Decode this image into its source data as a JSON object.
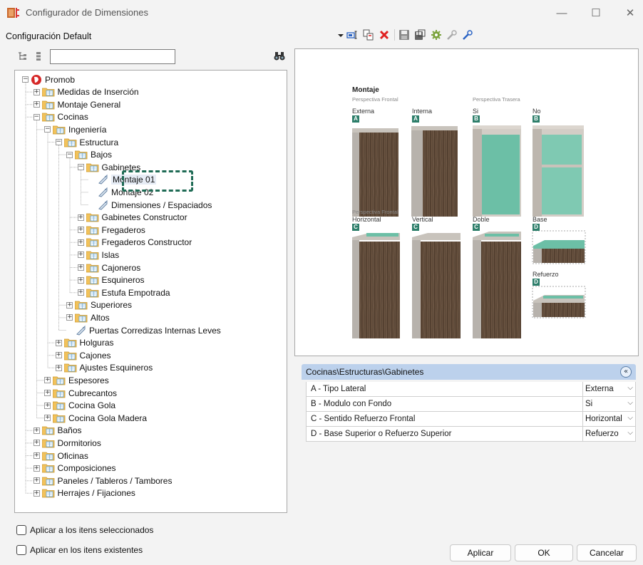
{
  "window": {
    "title": "Configurador de Dimensiones",
    "minimize_glyph": "—",
    "maximize_glyph": "☐",
    "close_glyph": "✕"
  },
  "config": {
    "label": "Configuración Default",
    "toolbar_icons": [
      "dropdown-arrow-icon",
      "rename-icon",
      "copy-icon",
      "delete-icon",
      "save-icon",
      "save-as-icon",
      "settings-icon",
      "link-icon",
      "unlink-icon"
    ]
  },
  "search": {
    "value": "",
    "placeholder": ""
  },
  "tree": [
    {
      "label": "Promob",
      "level": 0,
      "type": "root",
      "exp": "−"
    },
    {
      "label": "Medidas de Inserción",
      "level": 1,
      "type": "folder",
      "exp": "+"
    },
    {
      "label": "Montaje General",
      "level": 1,
      "type": "folder",
      "exp": "+"
    },
    {
      "label": "Cocinas",
      "level": 1,
      "type": "folder",
      "exp": "−"
    },
    {
      "label": "Ingeniería",
      "level": 2,
      "type": "folder",
      "exp": "−"
    },
    {
      "label": "Estructura",
      "level": 3,
      "type": "folder",
      "exp": "−"
    },
    {
      "label": "Bajos",
      "level": 4,
      "type": "folder",
      "exp": "−"
    },
    {
      "label": "Gabinetes",
      "level": 5,
      "type": "folder",
      "exp": "−"
    },
    {
      "label": "Montaje 01",
      "level": 6,
      "type": "item",
      "exp": "",
      "selected": true
    },
    {
      "label": "Montaje 02",
      "level": 6,
      "type": "item",
      "exp": ""
    },
    {
      "label": "Dimensiones / Espaciados",
      "level": 6,
      "type": "item",
      "exp": ""
    },
    {
      "label": "Gabinetes Constructor",
      "level": 5,
      "type": "folder",
      "exp": "+"
    },
    {
      "label": "Fregaderos",
      "level": 5,
      "type": "folder",
      "exp": "+"
    },
    {
      "label": "Fregaderos Constructor",
      "level": 5,
      "type": "folder",
      "exp": "+"
    },
    {
      "label": "Islas",
      "level": 5,
      "type": "folder",
      "exp": "+"
    },
    {
      "label": "Cajoneros",
      "level": 5,
      "type": "folder",
      "exp": "+"
    },
    {
      "label": "Esquineros",
      "level": 5,
      "type": "folder",
      "exp": "+"
    },
    {
      "label": "Estufa Empotrada",
      "level": 5,
      "type": "folder",
      "exp": "+"
    },
    {
      "label": "Superiores",
      "level": 4,
      "type": "folder",
      "exp": "+"
    },
    {
      "label": "Altos",
      "level": 4,
      "type": "folder",
      "exp": "+"
    },
    {
      "label": "Puertas Corredizas Internas Leves",
      "level": 4,
      "type": "item",
      "exp": ""
    },
    {
      "label": "Holguras",
      "level": 3,
      "type": "folder",
      "exp": "+"
    },
    {
      "label": "Cajones",
      "level": 3,
      "type": "folder",
      "exp": "+"
    },
    {
      "label": "Ajustes Esquineros",
      "level": 3,
      "type": "folder",
      "exp": "+"
    },
    {
      "label": "Espesores",
      "level": 2,
      "type": "folder",
      "exp": "+"
    },
    {
      "label": "Cubrecantos",
      "level": 2,
      "type": "folder",
      "exp": "+"
    },
    {
      "label": "Cocina Gola",
      "level": 2,
      "type": "folder",
      "exp": "+"
    },
    {
      "label": "Cocina Gola Madera",
      "level": 2,
      "type": "folder",
      "exp": "+"
    },
    {
      "label": "Baños",
      "level": 1,
      "type": "folder",
      "exp": "+"
    },
    {
      "label": "Dormitorios",
      "level": 1,
      "type": "folder",
      "exp": "+"
    },
    {
      "label": "Oficinas",
      "level": 1,
      "type": "folder",
      "exp": "+"
    },
    {
      "label": "Composiciones",
      "level": 1,
      "type": "folder",
      "exp": "+"
    },
    {
      "label": "Paneles / Tableros / Tambores",
      "level": 1,
      "type": "folder",
      "exp": "+"
    },
    {
      "label": "Herrajes / Fijaciones",
      "level": 1,
      "type": "folder",
      "exp": "+"
    }
  ],
  "preview": {
    "title": "Montaje",
    "front_caption": "Perspectiva Frontal",
    "back_caption": "Perspectiva Trasera",
    "front_caption_2": "Perspectiva Frontal",
    "row1": [
      {
        "label": "Externa",
        "badge": "A"
      },
      {
        "label": "Interna",
        "badge": "A"
      },
      {
        "label": "Si",
        "badge": "B"
      },
      {
        "label": "No",
        "badge": "B"
      }
    ],
    "row2": [
      {
        "label": "Horizontal",
        "badge": "C"
      },
      {
        "label": "Vertical",
        "badge": "C"
      },
      {
        "label": "Doble",
        "badge": "C"
      },
      {
        "label": "Base",
        "badge": "D"
      }
    ],
    "extra": {
      "label": "Refuerzo",
      "badge": "D"
    }
  },
  "propgrid": {
    "category": "Cocinas\\Estructuras\\Gabinetes",
    "collapse_glyph": "«",
    "rows": [
      {
        "name": "A - Tipo Lateral",
        "value": "Externa"
      },
      {
        "name": "B - Modulo con Fondo",
        "value": "Si"
      },
      {
        "name": "C - Sentido Refuerzo Frontal",
        "value": "Horizontal"
      },
      {
        "name": "D - Base Superior o Refuerzo Superior",
        "value": "Refuerzo"
      }
    ]
  },
  "options": {
    "apply_selected": "Aplicar a los itens seleccionados",
    "apply_existing": "Aplicar en los itens existentes"
  },
  "buttons": {
    "apply": "Aplicar",
    "ok": "OK",
    "cancel": "Cancelar"
  },
  "colors": {
    "accent_teal": "#2d7e6a",
    "highlight_dashed": "#1f6b55",
    "category_header": "#bcd1ec"
  }
}
